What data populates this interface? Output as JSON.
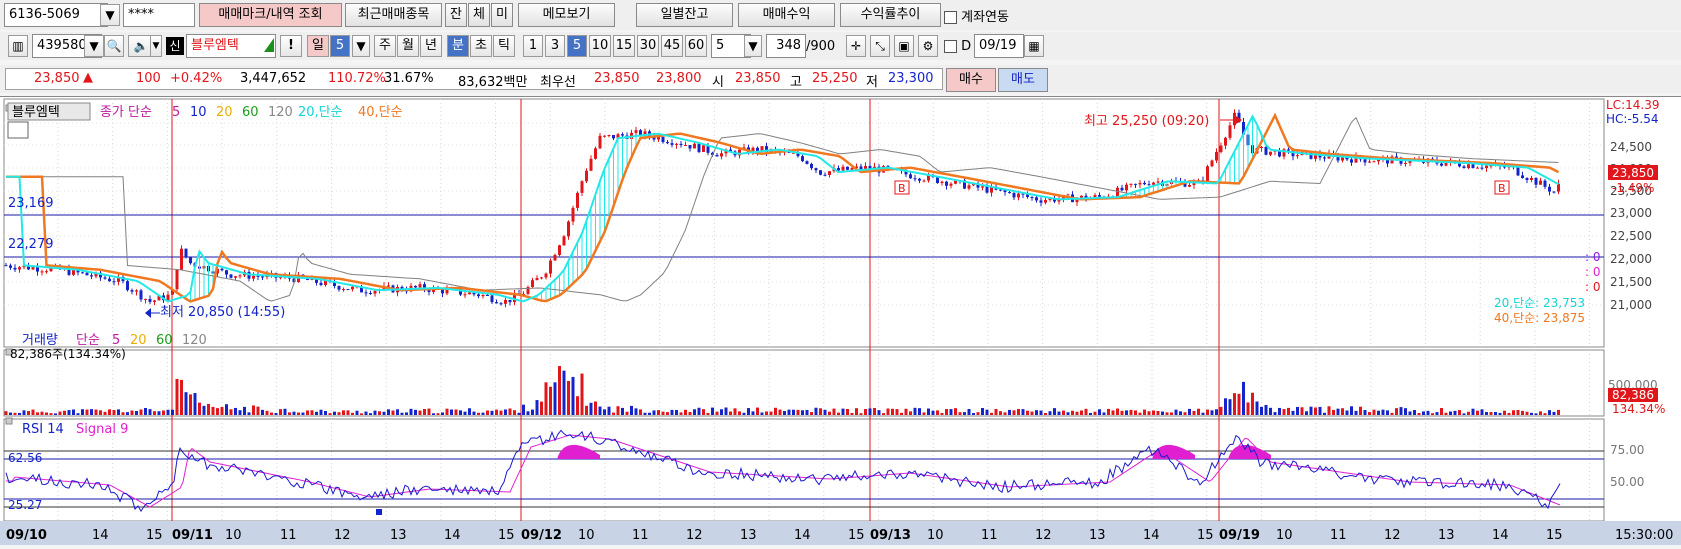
{
  "toolbar1": {
    "account": "6136-5069",
    "password": "****",
    "btn_mark": "매매마크/내역 조회",
    "btn_recent": "최근매매종목",
    "btn_jan": "잔",
    "btn_che": "체",
    "btn_mi": "미",
    "btn_memo": "메모보기",
    "btn_daily_balance": "일별잔고",
    "btn_profit": "매매수익",
    "btn_return": "수익률추이",
    "account_link_label": "계좌연동"
  },
  "toolbar2": {
    "code": "439580",
    "credit_mark": "신",
    "stock_name": "블루엠텍",
    "alert": "!",
    "period_il": "일",
    "period_num": "5",
    "period_ju": "주",
    "period_wol": "월",
    "period_nyeon": "년",
    "period_bun": "분",
    "period_cho": "초",
    "period_tik": "틱",
    "minute_options": [
      "1",
      "3",
      "5",
      "10",
      "15",
      "30",
      "45",
      "60"
    ],
    "minute_selected": "5",
    "count_select": "5",
    "bar_count": "348",
    "bar_total": "/900",
    "date_label": "D",
    "date_value": "09/19"
  },
  "quote": {
    "price": "23,850",
    "arrow": "▲",
    "change": "100",
    "change_rate": "+0.42%",
    "volume": "3,447,652",
    "volume_ratio": "110.72%",
    "turnover_ratio": "31.67%",
    "amount": "83,632백만",
    "best_label": "최우선",
    "ask": "23,850",
    "bid": "23,800",
    "open_label": "시",
    "open": "23,850",
    "high_label": "고",
    "high": "25,250",
    "low_label": "저",
    "low": "23,300",
    "buy_label": "매수",
    "sell_label": "매도"
  },
  "price_pane": {
    "stock_tag": "블루엠텍",
    "legend_close": "종가 단순",
    "legend_ma": [
      "5",
      "10",
      "20",
      "60",
      "120"
    ],
    "legend_ma20": "20,단순",
    "legend_ma40": "40,단순",
    "hline_1": "23,169",
    "hline_2": "22,279",
    "high_annot": "최고 25,250 (09:20)",
    "low_annot": "최저 20,850 (14:55)",
    "lc": "LC:14.39",
    "hc": "HC:-5.54",
    "price_tag": "23,850",
    "price_tag_pct": "-1.49%",
    "y_ticks": [
      "24,500",
      "24,000",
      "23,500",
      "23,000",
      "22,500",
      "22,000",
      "21,500",
      "21,000"
    ],
    "side_vals": [
      ": 0",
      ": 0",
      ": 0"
    ],
    "ma20_val": "20,단순: 23,753",
    "ma40_val": "40,단순: 23,875",
    "buy_marker": "B"
  },
  "volume_pane": {
    "title": "거래량",
    "legend_simple": "단순",
    "legend_ma": [
      "5",
      "20",
      "60",
      "120"
    ],
    "info": "82,386주(134.34%)",
    "y_tick": "500,000",
    "tag_value": "82,386",
    "tag_pct": "134.34%"
  },
  "rsi_pane": {
    "title": "RSI 14",
    "signal": "Signal 9",
    "level_high": "62.56",
    "level_low": "25.27",
    "y_ticks": [
      "75.00",
      "50.00"
    ]
  },
  "time_axis": {
    "labels": [
      {
        "t": "09/10",
        "d": true
      },
      {
        "t": "14"
      },
      {
        "t": "15"
      },
      {
        "t": "09/11",
        "d": true
      },
      {
        "t": "10"
      },
      {
        "t": "11"
      },
      {
        "t": "12"
      },
      {
        "t": "13"
      },
      {
        "t": "14"
      },
      {
        "t": "15"
      },
      {
        "t": "09/12",
        "d": true
      },
      {
        "t": "10"
      },
      {
        "t": "11"
      },
      {
        "t": "12"
      },
      {
        "t": "13"
      },
      {
        "t": "14"
      },
      {
        "t": "15"
      },
      {
        "t": "09/13",
        "d": true
      },
      {
        "t": "10"
      },
      {
        "t": "11"
      },
      {
        "t": "12"
      },
      {
        "t": "13"
      },
      {
        "t": "14"
      },
      {
        "t": "15"
      },
      {
        "t": "09/19",
        "d": true
      },
      {
        "t": "10"
      },
      {
        "t": "11"
      },
      {
        "t": "12"
      },
      {
        "t": "13"
      },
      {
        "t": "14"
      },
      {
        "t": "15"
      }
    ],
    "end_time": "15:30:00"
  },
  "colors": {
    "up": "#e0161b",
    "down": "#1424c8",
    "ma20": "#22e8e8",
    "ma40": "#f07820",
    "rsi": "#1a1acc",
    "signal": "#e020d0"
  }
}
